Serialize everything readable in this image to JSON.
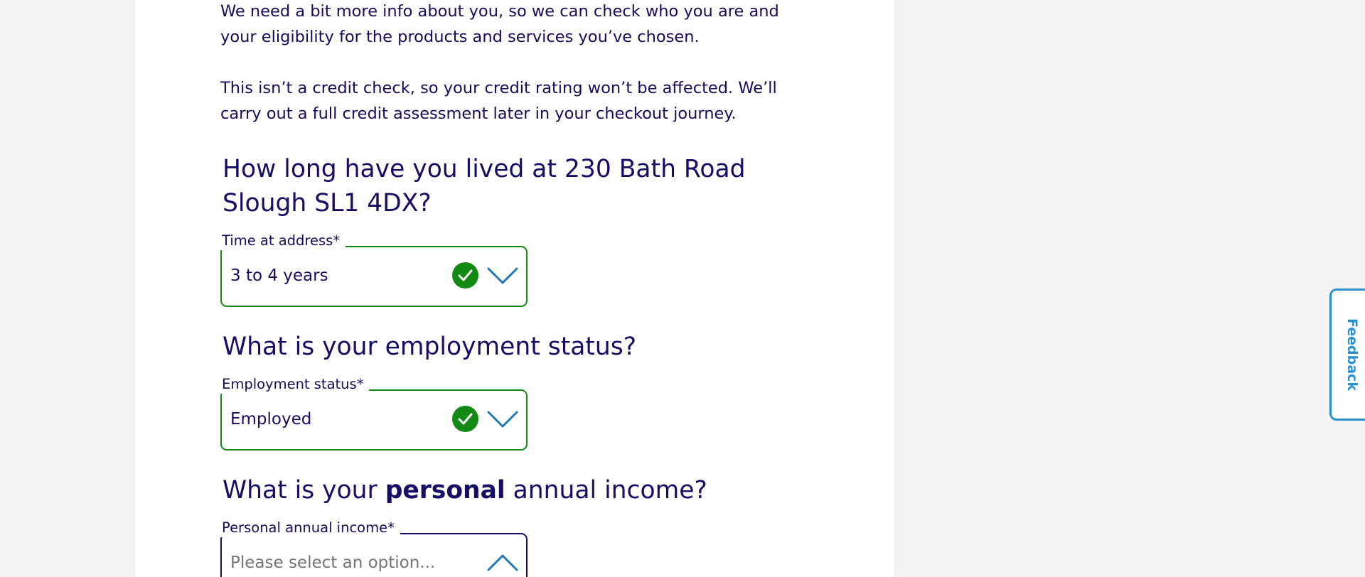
{
  "intro": {
    "paragraph1": "We need a bit more info about you, so we can check who you are and your eligibility for the products and services you’ve chosen.",
    "paragraph2": "This isn’t a credit check, so your credit rating won’t be affected. We’ll carry out a full credit assessment later in your checkout journey."
  },
  "questions": {
    "address": {
      "text": "How long have you lived at 230 Bath Road Slough SL1 4DX?",
      "field_label": "Time at address*",
      "value": "3 to 4 years",
      "status_icon": "check-circle-icon",
      "chevron": "chevron-down-icon"
    },
    "employment": {
      "text": "What is your employment status?",
      "field_label": "Employment status*",
      "value": "Employed",
      "status_icon": "check-circle-icon",
      "chevron": "chevron-down-icon"
    },
    "income": {
      "text_before": "What is your ",
      "text_bold": "personal",
      "text_after": " annual income?",
      "field_label": "Personal annual income*",
      "placeholder": "Please select an option...",
      "chevron": "chevron-up-icon"
    }
  },
  "feedback": {
    "label": "Feedback"
  },
  "colors": {
    "text_primary": "#160e66",
    "valid_green": "#138a13",
    "accent_blue": "#2a8fd0",
    "chevron_blue": "#2277b8",
    "page_bg": "#f4f4f4",
    "placeholder_grey": "#747474"
  }
}
